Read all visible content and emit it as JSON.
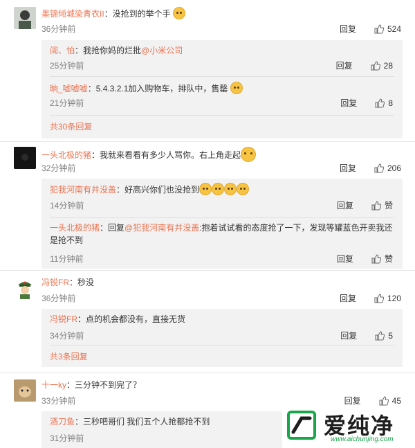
{
  "comments": [
    {
      "user": "墨锦倾城染青衣II",
      "text": "：没抢到的举个手",
      "time": "36分钟前",
      "reply_label": "回复",
      "likes": "524",
      "replies": [
        {
          "user": "阔、怕",
          "text": "：我抢你妈的烂批",
          "mention": "@小米公司",
          "time": "25分钟前",
          "reply_label": "回复",
          "likes": "28"
        },
        {
          "user": "晌_嘘嘘嘘",
          "text": "：5.4.3.2.1加入购物车，排队中，售罄",
          "time": "21分钟前",
          "reply_label": "回复",
          "likes": "8"
        }
      ],
      "more": "共30条回复"
    },
    {
      "user": "一头北极的猪",
      "text": "：我就来看看有多少人骂你。右上角走起",
      "time": "32分钟前",
      "reply_label": "回复",
      "likes": "206",
      "replies": [
        {
          "user": "犯我河南有井没盖",
          "text": "：好高兴你们也没抢到",
          "time": "14分钟前",
          "reply_label": "回复",
          "likes": "赞"
        },
        {
          "user": "一头北极的猪",
          "text": "：回复",
          "mention": "@犯我河南有井没盖",
          "text2": ":抱着试试看的态度抢了一下，发现等罐蓝色开卖我还",
          "text3": "是抢不到",
          "time": "11分钟前",
          "reply_label": "回复",
          "likes": "赞"
        }
      ]
    },
    {
      "user": "冯锐FR",
      "text": "：秒没",
      "time": "36分钟前",
      "reply_label": "回复",
      "likes": "120",
      "replies": [
        {
          "user": "冯锐FR",
          "text": "：点的机会都没有，直接无货",
          "time": "34分钟前",
          "reply_label": "回复",
          "likes": "5"
        }
      ],
      "more": "共3条回复"
    },
    {
      "user": "十一ky",
      "text": "：三分钟不到完了？",
      "time": "33分钟前",
      "reply_label": "回复",
      "likes": "45",
      "replies": [
        {
          "user": "酒刀鱼",
          "text": "：三秒吧哥们  我们五个人抢都抢不到",
          "time": "31分钟前"
        }
      ]
    }
  ],
  "watermark": {
    "title": "爱纯净",
    "url": "www.aichunjing.com"
  },
  "colors": {
    "username": "#eb7350",
    "time": "#808080",
    "sub_bg": "#f2f2f2",
    "divider": "#e6e6e6"
  }
}
